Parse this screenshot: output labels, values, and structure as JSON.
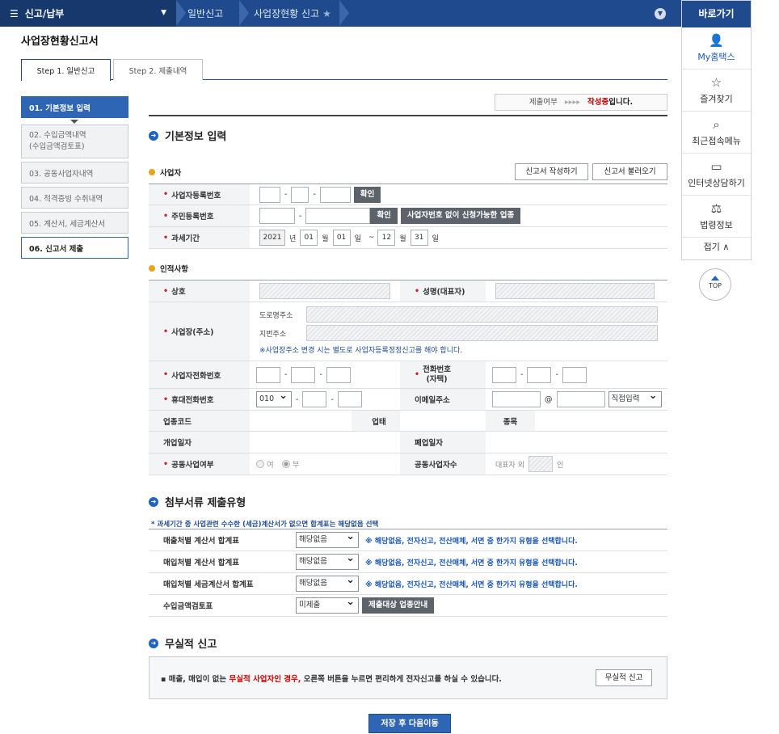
{
  "topnav": {
    "menu": "신고/납부",
    "crumb1": "일반신고",
    "crumb2": "사업장현황 신고",
    "quicklinks_title": "바로가기"
  },
  "quick": {
    "items": [
      {
        "label": "My홈택스",
        "icon": "user-icon"
      },
      {
        "label": "즐겨찾기",
        "icon": "star-icon"
      },
      {
        "label": "최근접속메뉴",
        "icon": "recent-icon"
      },
      {
        "label": "인터넷상담하기",
        "icon": "laptop-icon"
      },
      {
        "label": "법령정보",
        "icon": "gavel-icon"
      }
    ],
    "fold": "접기 ∧",
    "top": "TOP"
  },
  "page": {
    "title": "사업장현황신고서"
  },
  "tabs": [
    "Step 1. 일반신고",
    "Step 2. 제출내역"
  ],
  "steps": [
    "01. 기본정보 입력",
    "02. 수입금액내역\n(수입금액검토표)",
    "03. 공동사업자내역",
    "04. 적격증빙 수취내역",
    "05. 계산서, 세금계산서",
    "06. 신고서 제출"
  ],
  "status": {
    "prefix": "제출여부",
    "arrows": "▸▸▸▸",
    "state": "작성중",
    "suffix": "입니다."
  },
  "basic": {
    "title": "기본정보 입력",
    "sub_business": "사업자",
    "btn_write": "신고서 작성하기",
    "btn_load": "신고서 불러오기",
    "brn_label": "사업자등록번호",
    "confirm": "확인",
    "rrn_label": "주민등록번호",
    "no_brn_btn": "사업자번호 없이 신청가능한 업종",
    "period_label": "과세기간",
    "year": "2021",
    "nyeon": "년",
    "m1": "01",
    "wol": "월",
    "d1": "01",
    "il": "일",
    "tilde": "~",
    "m2": "12",
    "d2": "31"
  },
  "person": {
    "sub": "인적사항",
    "trade_label": "상호",
    "name_label": "성명(대표자)",
    "addr_label": "사업장(주소)",
    "road": "도로명주소",
    "jibun": "지번주소",
    "addr_note": "※사업장주소 변경 시는 별도로 사업자등록정정신고를 해야 합니다.",
    "biz_phone": "사업자전화번호",
    "home_phone": "전화번호\n(자택)",
    "mobile": "휴대전화번호",
    "mobile_prefix": "010",
    "email": "이메일주소",
    "at": "@",
    "email_sel": "직접입력",
    "industry_code": "업종코드",
    "business_type": "업태",
    "item": "종목",
    "open_date": "개업일자",
    "close_date": "폐업일자",
    "joint_label": "공동사업여부",
    "yes": "여",
    "no": "부",
    "joint_count": "공동사업자수",
    "rep_prefix": "대표자 외",
    "persons": "인"
  },
  "attach": {
    "title": "첨부서류 제출유형",
    "note": "* 과세기간 중 사업관련 수수한 (세금)계산서가 없으면 합계표는 해당없음 선택",
    "rows": [
      {
        "label": "매출처별 계산서 합계표",
        "sel": "해당없음",
        "note": "※ 해당없음, 전자신고, 전산매체, 서면 중 한가지 유형을 선택합니다."
      },
      {
        "label": "매입처별 계산서 합계표",
        "sel": "해당없음",
        "note": "※ 해당없음, 전자신고, 전산매체, 서면 중 한가지 유형을 선택합니다."
      },
      {
        "label": "매입처별 세금계산서 합계표",
        "sel": "해당없음",
        "note": "※ 해당없음, 전자신고, 전산매체, 서면 중 한가지 유형을 선택합니다."
      },
      {
        "label": "수입금액검토표",
        "sel": "미제출",
        "btn": "제출대상 업종안내"
      }
    ]
  },
  "nil": {
    "title": "무실적 신고",
    "text_a": "▪ 매출, 매입이 없는 ",
    "text_red": "무실적 사업자인 경우,",
    "text_b": " 오른쪽 버튼을 누르면 편리하게 전자신고를 하실 수 있습니다.",
    "btn": "무실적 신고"
  },
  "footer": {
    "save_next": "저장 후 다음이동"
  }
}
